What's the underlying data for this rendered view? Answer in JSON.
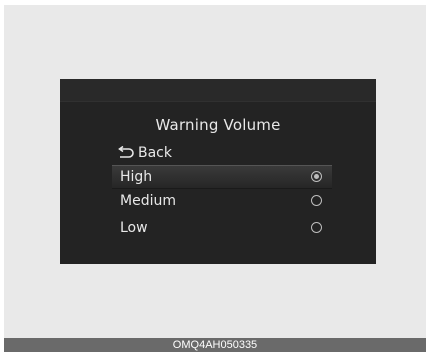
{
  "screen": {
    "title": "Warning Volume",
    "back_label": "Back",
    "options": [
      {
        "label": "High",
        "selected": true
      },
      {
        "label": "Medium",
        "selected": false
      },
      {
        "label": "Low",
        "selected": false
      }
    ]
  },
  "caption": "OMQ4AH050335",
  "icons": {
    "back": "back-arrow-icon",
    "radio_selected": "radio-selected-icon",
    "radio_unselected": "radio-unselected-icon"
  },
  "colors": {
    "screen_background": "#232323",
    "text": "#e8e8e8",
    "caption_bar": "#6a6a6a"
  }
}
